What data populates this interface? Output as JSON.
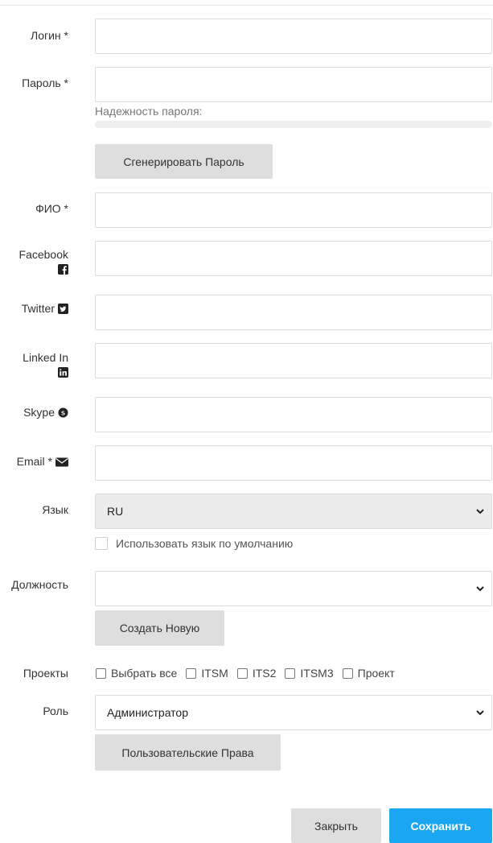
{
  "form": {
    "login": {
      "label": "Логин *",
      "value": ""
    },
    "password": {
      "label": "Пароль *",
      "value": "",
      "strength_label": "Надежность пароля:",
      "strength": 0
    },
    "generate_button": "Сгенерировать Пароль",
    "fullname": {
      "label": "ФИО *",
      "value": ""
    },
    "facebook": {
      "label": "Facebook",
      "icon": "facebook-icon",
      "value": ""
    },
    "twitter": {
      "label": "Twitter",
      "icon": "twitter-icon",
      "value": ""
    },
    "linkedin": {
      "label": "Linked In",
      "icon": "linkedin-icon",
      "value": ""
    },
    "skype": {
      "label": "Skype",
      "icon": "skype-icon",
      "value": ""
    },
    "email": {
      "label": "Email *",
      "icon": "envelope-icon",
      "value": ""
    },
    "language": {
      "label": "Язык",
      "value": "RU",
      "default_checkbox_label": "Использовать язык по умолчанию",
      "use_default": false
    },
    "position": {
      "label": "Должность",
      "value": ""
    },
    "create_button": "Создать Новую",
    "projects": {
      "label": "Проекты",
      "options": [
        "Выбрать все",
        "ITSM",
        "ITS2",
        "ITSM3",
        "Проект"
      ]
    },
    "role": {
      "label": "Роль",
      "value": "Администратор"
    },
    "custom_rights_button": "Пользовательские Права"
  },
  "footer": {
    "close_button": "Закрыть",
    "save_button": "Сохранить"
  },
  "colors": {
    "primary": "#1aa6f0",
    "button_grey": "#dedede"
  }
}
